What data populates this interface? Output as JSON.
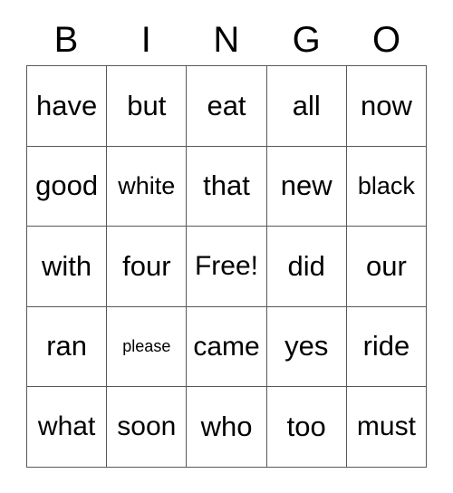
{
  "card": {
    "title": "BINGO",
    "free_space_label": "Free!",
    "columns": [
      "B",
      "I",
      "N",
      "G",
      "O"
    ],
    "colors": {
      "background": "#ffffff",
      "text": "#000000",
      "grid_line": "#595959"
    },
    "rows": [
      [
        {
          "text": "have",
          "size": "fs-xl"
        },
        {
          "text": "but",
          "size": "fs-xl"
        },
        {
          "text": "eat",
          "size": "fs-xl"
        },
        {
          "text": "all",
          "size": "fs-xl"
        },
        {
          "text": "now",
          "size": "fs-xl"
        }
      ],
      [
        {
          "text": "good",
          "size": "fs-xl"
        },
        {
          "text": "white",
          "size": "fs-md"
        },
        {
          "text": "that",
          "size": "fs-xl"
        },
        {
          "text": "new",
          "size": "fs-xl"
        },
        {
          "text": "black",
          "size": "fs-md"
        }
      ],
      [
        {
          "text": "with",
          "size": "fs-xl"
        },
        {
          "text": "four",
          "size": "fs-xl"
        },
        {
          "text": "Free!",
          "size": "fs-lg"
        },
        {
          "text": "did",
          "size": "fs-xl"
        },
        {
          "text": "our",
          "size": "fs-xl"
        }
      ],
      [
        {
          "text": "ran",
          "size": "fs-xl"
        },
        {
          "text": "please",
          "size": "fs-xs"
        },
        {
          "text": "came",
          "size": "fs-lg"
        },
        {
          "text": "yes",
          "size": "fs-xl"
        },
        {
          "text": "ride",
          "size": "fs-xl"
        }
      ],
      [
        {
          "text": "what",
          "size": "fs-lg"
        },
        {
          "text": "soon",
          "size": "fs-lg"
        },
        {
          "text": "who",
          "size": "fs-xl"
        },
        {
          "text": "too",
          "size": "fs-xl"
        },
        {
          "text": "must",
          "size": "fs-lg"
        }
      ]
    ]
  }
}
